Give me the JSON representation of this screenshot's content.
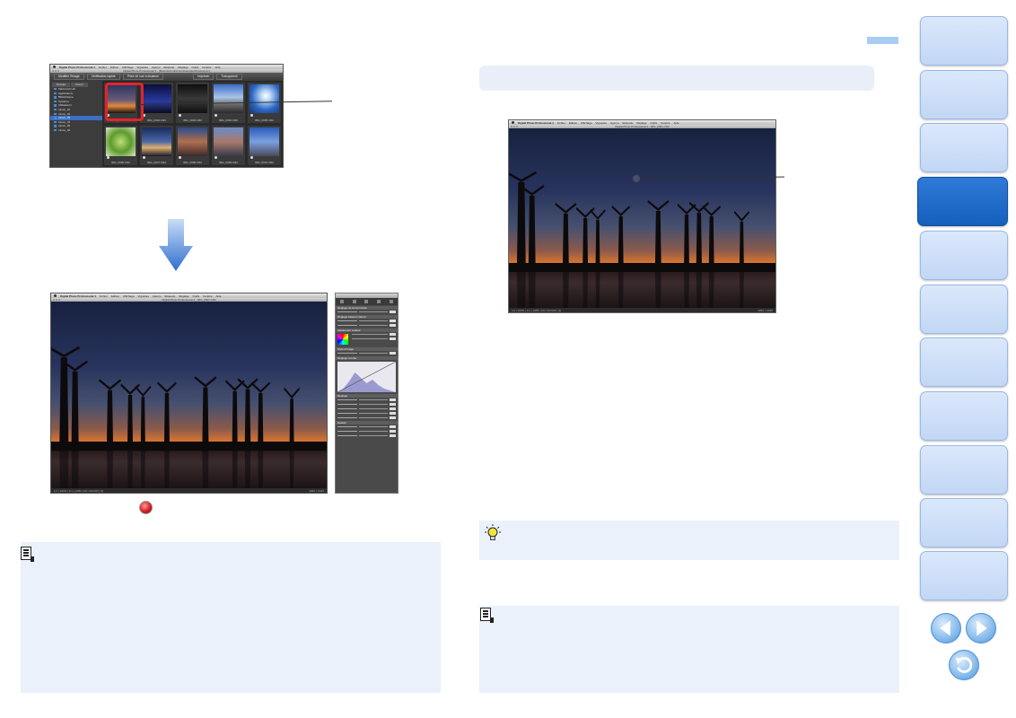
{
  "menubar": {
    "app": "Digital Photo Professional 4",
    "items": [
      "Fichier",
      "Edition",
      "Affichage",
      "Vignettes",
      "Aperçu",
      "Etiquette",
      "Réglage",
      "Outils",
      "Fenêtre",
      "Aide"
    ]
  },
  "browser_window": {
    "title": "Digital Photo Professional 4 - [Macintosh HD/Users/sample/Pictures/xxx]",
    "toolbar": [
      "Modifier l'image",
      "Vérification rapide",
      "Prise de vue à distance",
      "Imprimer",
      "Transparent"
    ],
    "tree_tabs": [
      "Dossier",
      "Favori"
    ],
    "tree_items": [
      "Macintosh HD",
      "Applications",
      "Bibliothèque",
      "Système",
      "Utilisateurs",
      "canon_01",
      "canon_02",
      "canon_03",
      "canon_04",
      "canon_05",
      "canon_06"
    ],
    "thumbs": [
      {
        "name": "IMG_0001.CR2",
        "kind": "sunset"
      },
      {
        "name": "IMG_0002.CR2",
        "kind": "night"
      },
      {
        "name": "IMG_0003.CR2",
        "kind": "dark"
      },
      {
        "name": "IMG_0004.CR2",
        "kind": "city"
      },
      {
        "name": "IMG_0005.CR2",
        "kind": "sky"
      },
      {
        "name": "IMG_0006.CR2",
        "kind": "leaf"
      },
      {
        "name": "IMG_0007.CR2",
        "kind": "harbor"
      },
      {
        "name": "IMG_0008.CR2",
        "kind": "street"
      },
      {
        "name": "IMG_0009.CR2",
        "kind": "people"
      },
      {
        "name": "IMG_0010.CR2",
        "kind": "tower"
      }
    ]
  },
  "edit_window": {
    "title": "Digital Photo Professional 4 - IMG_0001.CR2",
    "status_left": "1/1 | 100% | 1/1 | 1/250 | F8 | ISO100 | [1]",
    "status_right": "4096 × 2048"
  },
  "tool_palette": {
    "title": "Palette d'outils",
    "sections": [
      "Réglage de la luminosité",
      "Réglage balance blancs",
      "Ajustement couleur",
      "Style d'image",
      "Réglage courbe",
      "Réglage",
      "Netteté"
    ],
    "rows": [
      "Luminosité",
      "Contraste",
      "Lumières",
      "Ombres",
      "Niveau de couleur",
      "Saturation",
      "Teinte",
      "Finesse",
      "Seuil"
    ]
  },
  "single_window": {
    "title": "Digital Photo Professional 4 - IMG_0001.CR2",
    "status_left": "1/1 | 100% | 1/1 | 1/250 | F8 | ISO100 | [1]",
    "status_right": "4096 × 2048"
  },
  "colors": {
    "accent": "#1a66c7",
    "nav_tab": "#c8dbf5",
    "nav_active": "#1c67c8",
    "note_bg": "#eaf1fb",
    "selection": "#e2242a"
  },
  "icons": {
    "note": "memo-icon",
    "tip": "lightbulb-icon",
    "prev": "arrow-left-icon",
    "next": "arrow-right-icon",
    "back": "return-icon",
    "stop": "red-stop-icon"
  }
}
